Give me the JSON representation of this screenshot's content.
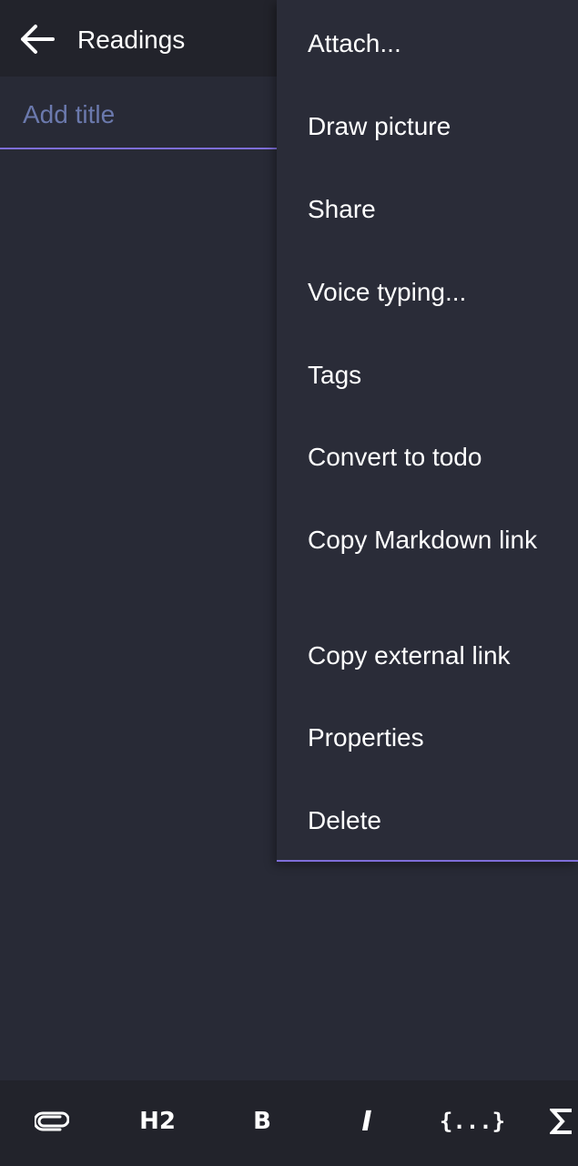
{
  "header": {
    "title": "Readings",
    "back_icon": "arrow-left-icon"
  },
  "note": {
    "title_placeholder": "Add title",
    "title_value": ""
  },
  "menu": {
    "items": [
      {
        "label": "Attach..."
      },
      {
        "label": "Draw picture"
      },
      {
        "label": "Share"
      },
      {
        "label": "Voice typing..."
      },
      {
        "label": "Tags"
      },
      {
        "label": "Convert to todo"
      },
      {
        "label": "Copy Markdown link"
      },
      {
        "label": "Copy external link"
      },
      {
        "label": "Properties"
      },
      {
        "label": "Delete"
      }
    ]
  },
  "toolbar": {
    "attach_icon": "paperclip-icon",
    "heading_label": "H2",
    "bold_label": "B",
    "italic_label": "I",
    "code_label": "{...}",
    "math_icon": "sigma-icon"
  },
  "colors": {
    "background": "#282a36",
    "header": "#22232b",
    "menu": "#2a2c38",
    "accent": "#7e6ed8",
    "placeholder": "#6b79ad"
  }
}
